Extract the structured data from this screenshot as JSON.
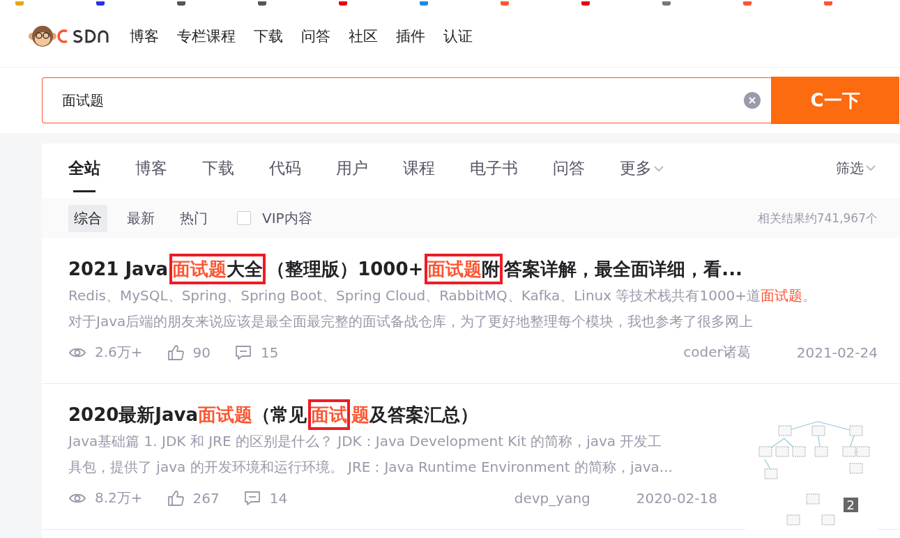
{
  "nav": {
    "items": [
      "博客",
      "专栏课程",
      "下载",
      "问答",
      "社区",
      "插件",
      "认证"
    ]
  },
  "search": {
    "value": "面试题",
    "button": "C一下"
  },
  "tabs": [
    {
      "label": "全站",
      "selected": true,
      "dropdown": false
    },
    {
      "label": "博客",
      "selected": false,
      "dropdown": false
    },
    {
      "label": "下载",
      "selected": false,
      "dropdown": false
    },
    {
      "label": "代码",
      "selected": false,
      "dropdown": false
    },
    {
      "label": "用户",
      "selected": false,
      "dropdown": false
    },
    {
      "label": "课程",
      "selected": false,
      "dropdown": false
    },
    {
      "label": "电子书",
      "selected": false,
      "dropdown": false
    },
    {
      "label": "问答",
      "selected": false,
      "dropdown": false
    },
    {
      "label": "更多",
      "selected": false,
      "dropdown": true
    }
  ],
  "filter_button": "筛选",
  "sorts": [
    {
      "label": "综合",
      "selected": true
    },
    {
      "label": "最新",
      "selected": false
    },
    {
      "label": "热门",
      "selected": false
    }
  ],
  "vip": {
    "label": "VIP内容",
    "checked": false
  },
  "result_count": "相关结果约741,967个",
  "results": [
    {
      "title": [
        {
          "kind": "text",
          "text": "2021 Java",
          "highlight": false
        },
        {
          "kind": "frame",
          "parts": [
            {
              "kind": "text",
              "text": "面试题",
              "highlight": true
            },
            {
              "kind": "text",
              "text": "大全",
              "highlight": false
            }
          ]
        },
        {
          "kind": "text",
          "text": "（整理版）1000+",
          "highlight": false
        },
        {
          "kind": "frame",
          "parts": [
            {
              "kind": "text",
              "text": "面试题",
              "highlight": true
            },
            {
              "kind": "text",
              "text": "附",
              "highlight": false
            }
          ]
        },
        {
          "kind": "text",
          "text": "答案详解，最全面详细，看...",
          "highlight": false
        }
      ],
      "lines": [
        [
          {
            "text": "Redis、MySQL、Spring、Spring Boot、Spring Cloud、RabbitMQ、Kafka、Linux 等技术栈共有1000+道",
            "highlight": false
          },
          {
            "text": "面试题",
            "highlight": true
          },
          {
            "text": "。",
            "highlight": false
          }
        ],
        [
          {
            "text": "对于Java后端的朋友来说应该是最全面最完整的面试备战仓库，为了更好地整理每个模块，我也参考了很多网上",
            "highlight": false
          }
        ]
      ],
      "views": "2.6万+",
      "likes": "90",
      "comments": "15",
      "author": "coder诸葛",
      "date": "2021-02-24"
    },
    {
      "title": [
        {
          "kind": "text",
          "text": "2020最新Java",
          "highlight": false
        },
        {
          "kind": "text",
          "text": "面试题",
          "highlight": true
        },
        {
          "kind": "text",
          "text": "（常见",
          "highlight": false
        },
        {
          "kind": "frame",
          "parts": [
            {
              "kind": "text",
              "text": "面试",
              "highlight": true
            }
          ]
        },
        {
          "kind": "text",
          "text": "题",
          "highlight": true
        },
        {
          "kind": "text",
          "text": "及答案汇总）",
          "highlight": false
        }
      ],
      "lines": [
        [
          {
            "text": "Java基础篇 1. JDK 和 JRE 的区别是什么？ JDK：Java Development Kit 的简称，java 开发工",
            "highlight": false
          }
        ],
        [
          {
            "text": "具包，提供了 java 的开发环境和运行环境。 JRE：Java Runtime Environment 的简称，java...",
            "highlight": false
          }
        ]
      ],
      "views": "8.2万+",
      "likes": "267",
      "comments": "14",
      "author": "devp_yang",
      "date": "2020-02-18",
      "thumbnail": {
        "kind": "picture",
        "badge": "2"
      }
    }
  ]
}
